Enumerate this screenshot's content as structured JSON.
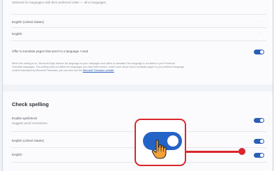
{
  "languages": {
    "header_text": "Selected for languages with their preferred order — all to languages",
    "items": [
      {
        "label": "English (United States)",
        "menu_icon": "more-icon"
      },
      {
        "label": "English",
        "menu_icon": "more-icon"
      }
    ]
  },
  "translate": {
    "label": "Offer to translate pages that aren't in a language I read",
    "description_line1": "When this setting is on, Microsoft Edge detects the language on your webpages and offers to translate if the language is not listed in your Preferred",
    "description_line2": "Translate languages. This setting does not affect the languages you have listed above. Learn more about how to translate pages in your preferred language.",
    "description_line3": "content translated by Microsoft Translator, you can also use the",
    "link_text": "Microsoft Translator website",
    "enabled": true
  },
  "check_spelling": {
    "title": "Check spelling",
    "items": [
      {
        "label": "Enable spellcheck",
        "sublabel": "Suggest word corrections",
        "enabled": true
      },
      {
        "label": "English (United States)",
        "sublabel": "",
        "enabled": true
      },
      {
        "label": "English",
        "sublabel": "",
        "enabled": true
      }
    ]
  },
  "annotation": {
    "accent_color": "#d9262a",
    "toggle_color": "#2463c6",
    "cursor_icon": "hand-pointer-icon"
  }
}
